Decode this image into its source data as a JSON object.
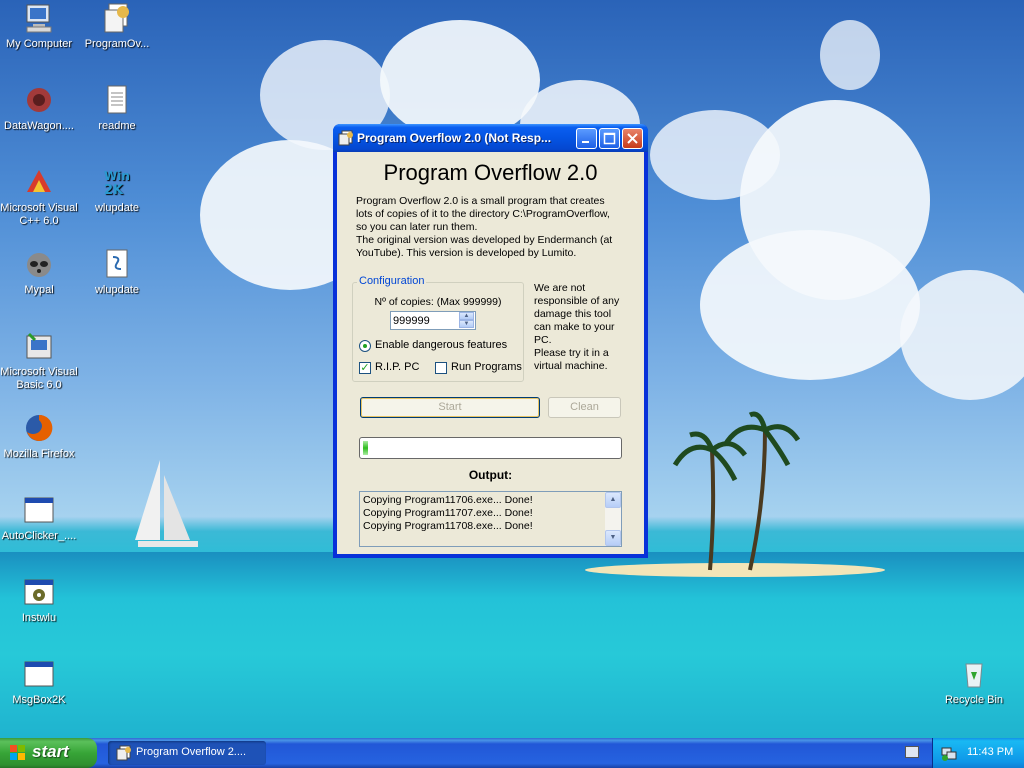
{
  "desktop": {
    "icons": [
      {
        "label": "My Computer",
        "icon": "my-computer-icon"
      },
      {
        "label": "ProgramOv...",
        "icon": "program-overflow-icon"
      },
      {
        "label": "DataWagon....",
        "icon": "datawagon-icon"
      },
      {
        "label": "readme",
        "icon": "notepad-document-icon"
      },
      {
        "label": "Microsoft Visual C++ 6.0",
        "icon": "visual-cpp-icon"
      },
      {
        "label": "wlupdate",
        "icon": "win2000-icon"
      },
      {
        "label": "Mypal",
        "icon": "mypal-raccoon-icon"
      },
      {
        "label": "wlupdate",
        "icon": "script-file-icon"
      },
      {
        "label": "Microsoft Visual Basic 6.0",
        "icon": "visual-basic-icon"
      },
      {
        "label": "Mozilla Firefox",
        "icon": "firefox-icon"
      },
      {
        "label": "AutoClicker_....",
        "icon": "application-window-icon"
      },
      {
        "label": "Instwlu",
        "icon": "installer-gear-icon"
      },
      {
        "label": "MsgBox2K",
        "icon": "application-window-icon"
      },
      {
        "label": "Recycle Bin",
        "icon": "recycle-bin-icon"
      }
    ]
  },
  "window": {
    "title": "Program Overflow 2.0 (Not Resp...",
    "heading": "Program Overflow 2.0",
    "description": [
      "Program Overflow 2.0 is a small program that creates",
      "lots of copies of it to the directory C:\\ProgramOverflow,",
      "so you can later run them.",
      "The original version was developed by Endermanch (at",
      "YouTube). This version is developed by Lumito."
    ],
    "config": {
      "legend": "Configuration",
      "copies_label": "Nº of copies: (Max 999999)",
      "copies_value": "999999",
      "dangerous_label": "Enable dangerous features",
      "dangerous_selected": true,
      "rip_label": "R.I.P. PC",
      "rip_checked": true,
      "run_label": "Run Programs",
      "run_checked": false
    },
    "warning": [
      "We are not",
      "responsible of any",
      "damage this tool",
      "can make to your",
      "PC.",
      "Please try it in a",
      "virtual machine."
    ],
    "start_label": "Start",
    "clean_label": "Clean",
    "progress": 0.02,
    "output_label": "Output:",
    "output_lines": [
      "Copying Program11706.exe... Done!",
      "Copying Program11707.exe... Done!",
      "Copying Program11708.exe... Done!"
    ]
  },
  "taskbar": {
    "start_label": "start",
    "task_label": "Program Overflow 2....",
    "clock": "11:43 PM"
  },
  "colors": {
    "titlebar": "#0454e3",
    "start_green": "#37a537",
    "progress_green": "#2fbd1f",
    "legend_blue": "#0046d5"
  }
}
